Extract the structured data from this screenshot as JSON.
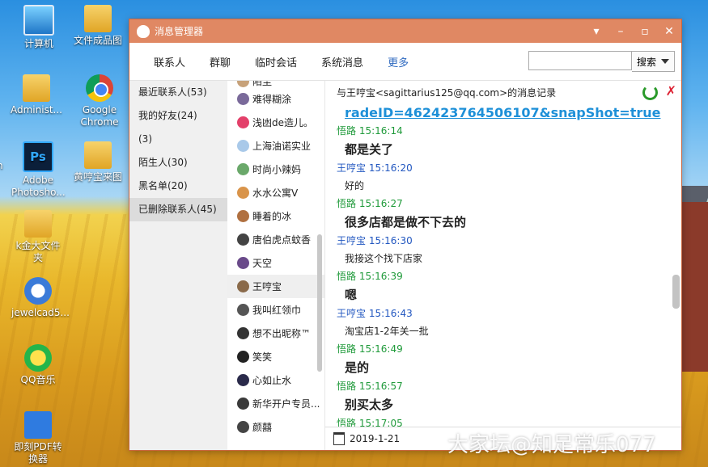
{
  "desktop": {
    "icons": [
      {
        "label": "计算机"
      },
      {
        "label": "文件成品图"
      },
      {
        "label": "Administ..."
      },
      {
        "label": "Google Chrome"
      },
      {
        "label": "Adobe Photosho..."
      },
      {
        "label": "黄哼宝来图"
      },
      {
        "label": "k金大文件夹"
      },
      {
        "label": "jewelcad5..."
      },
      {
        "label": "QQ音乐"
      },
      {
        "label": "即刻PDF转换器"
      },
      {
        "label": "n"
      }
    ],
    "watermark": "大家坛@知足常乐077"
  },
  "window": {
    "title": "消息管理器",
    "tabs": [
      "联系人",
      "群聊",
      "临时会话",
      "系统消息",
      "更多"
    ],
    "search": {
      "placeholder": "",
      "button": "搜索"
    },
    "categories": [
      "最近联系人(53)",
      "我的好友(24)",
      "(3)",
      "陌生人(30)",
      "黑名单(20)",
      "已删除联系人(45)"
    ],
    "contacts": [
      "陌尘",
      "难得糊涂",
      "浅凼de造儿。",
      "上海油诺实业",
      "时尚小辣妈",
      "水水公寓V",
      "睡着的冰",
      "唐伯虎点蚊香",
      "天空",
      "王哼宝",
      "我叫红领巾",
      "想不出昵称™",
      "笑笑",
      "心如止水",
      "新华开户专员...",
      "颜囍"
    ],
    "chat": {
      "header": "与王哼宝<sagittarius125@qq.com>的消息记录",
      "link": "radeID=462423764506107&snapShot=true",
      "messages": [
        {
          "sender": "悟路",
          "time": "15:16:14",
          "text": "都是关了",
          "big": true,
          "color": "g"
        },
        {
          "sender": "王哼宝",
          "time": "15:16:20",
          "text": "好的",
          "big": false,
          "color": "b"
        },
        {
          "sender": "悟路",
          "time": "15:16:27",
          "text": "很多店都是做不下去的",
          "big": true,
          "color": "g"
        },
        {
          "sender": "王哼宝",
          "time": "15:16:30",
          "text": "我接这个找下店家",
          "big": false,
          "color": "b"
        },
        {
          "sender": "悟路",
          "time": "15:16:39",
          "text": "嗯",
          "big": true,
          "color": "g"
        },
        {
          "sender": "王哼宝",
          "time": "15:16:43",
          "text": "淘宝店1-2年关一批",
          "big": false,
          "color": "b"
        },
        {
          "sender": "悟路",
          "time": "15:16:49",
          "text": "是的",
          "big": true,
          "color": "g"
        },
        {
          "sender": "悟路",
          "time": "15:16:57",
          "text": "别买太多",
          "big": true,
          "color": "g"
        },
        {
          "sender": "悟路",
          "time": "15:17:05",
          "text": "",
          "big": false,
          "color": "g"
        }
      ],
      "date": "2019-1-21"
    }
  },
  "colors": {
    "titlebar": "#e08863",
    "accent": "#2f6ac0",
    "sender_green": "#1f9a3a",
    "sender_blue": "#2257c0",
    "link": "#1e90d8"
  }
}
